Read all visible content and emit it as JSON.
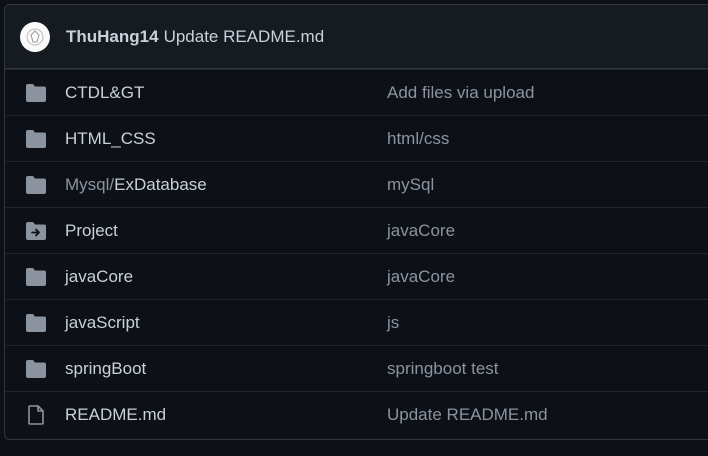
{
  "header": {
    "author": "ThuHang14",
    "message": "Update README.md"
  },
  "rows": [
    {
      "icon": "folder-icon",
      "prefix": "",
      "name": "CTDL&GT",
      "message": "Add files via upload"
    },
    {
      "icon": "folder-icon",
      "prefix": "",
      "name": "HTML_CSS",
      "message": "html/css"
    },
    {
      "icon": "folder-icon",
      "prefix": "Mysql/",
      "name": "ExDatabase",
      "message": "mySql"
    },
    {
      "icon": "submodule-folder-icon",
      "prefix": "",
      "name": "Project",
      "message": "javaCore"
    },
    {
      "icon": "folder-icon",
      "prefix": "",
      "name": "javaCore",
      "message": "javaCore"
    },
    {
      "icon": "folder-icon",
      "prefix": "",
      "name": "javaScript",
      "message": "js"
    },
    {
      "icon": "folder-icon",
      "prefix": "",
      "name": "springBoot",
      "message": "springboot test"
    },
    {
      "icon": "file-icon",
      "prefix": "",
      "name": "README.md",
      "message": "Update README.md"
    }
  ],
  "colors": {
    "folder": "#8b949e",
    "text": "#c9d1d9",
    "muted": "#8b949e",
    "background": "#0d1117"
  }
}
